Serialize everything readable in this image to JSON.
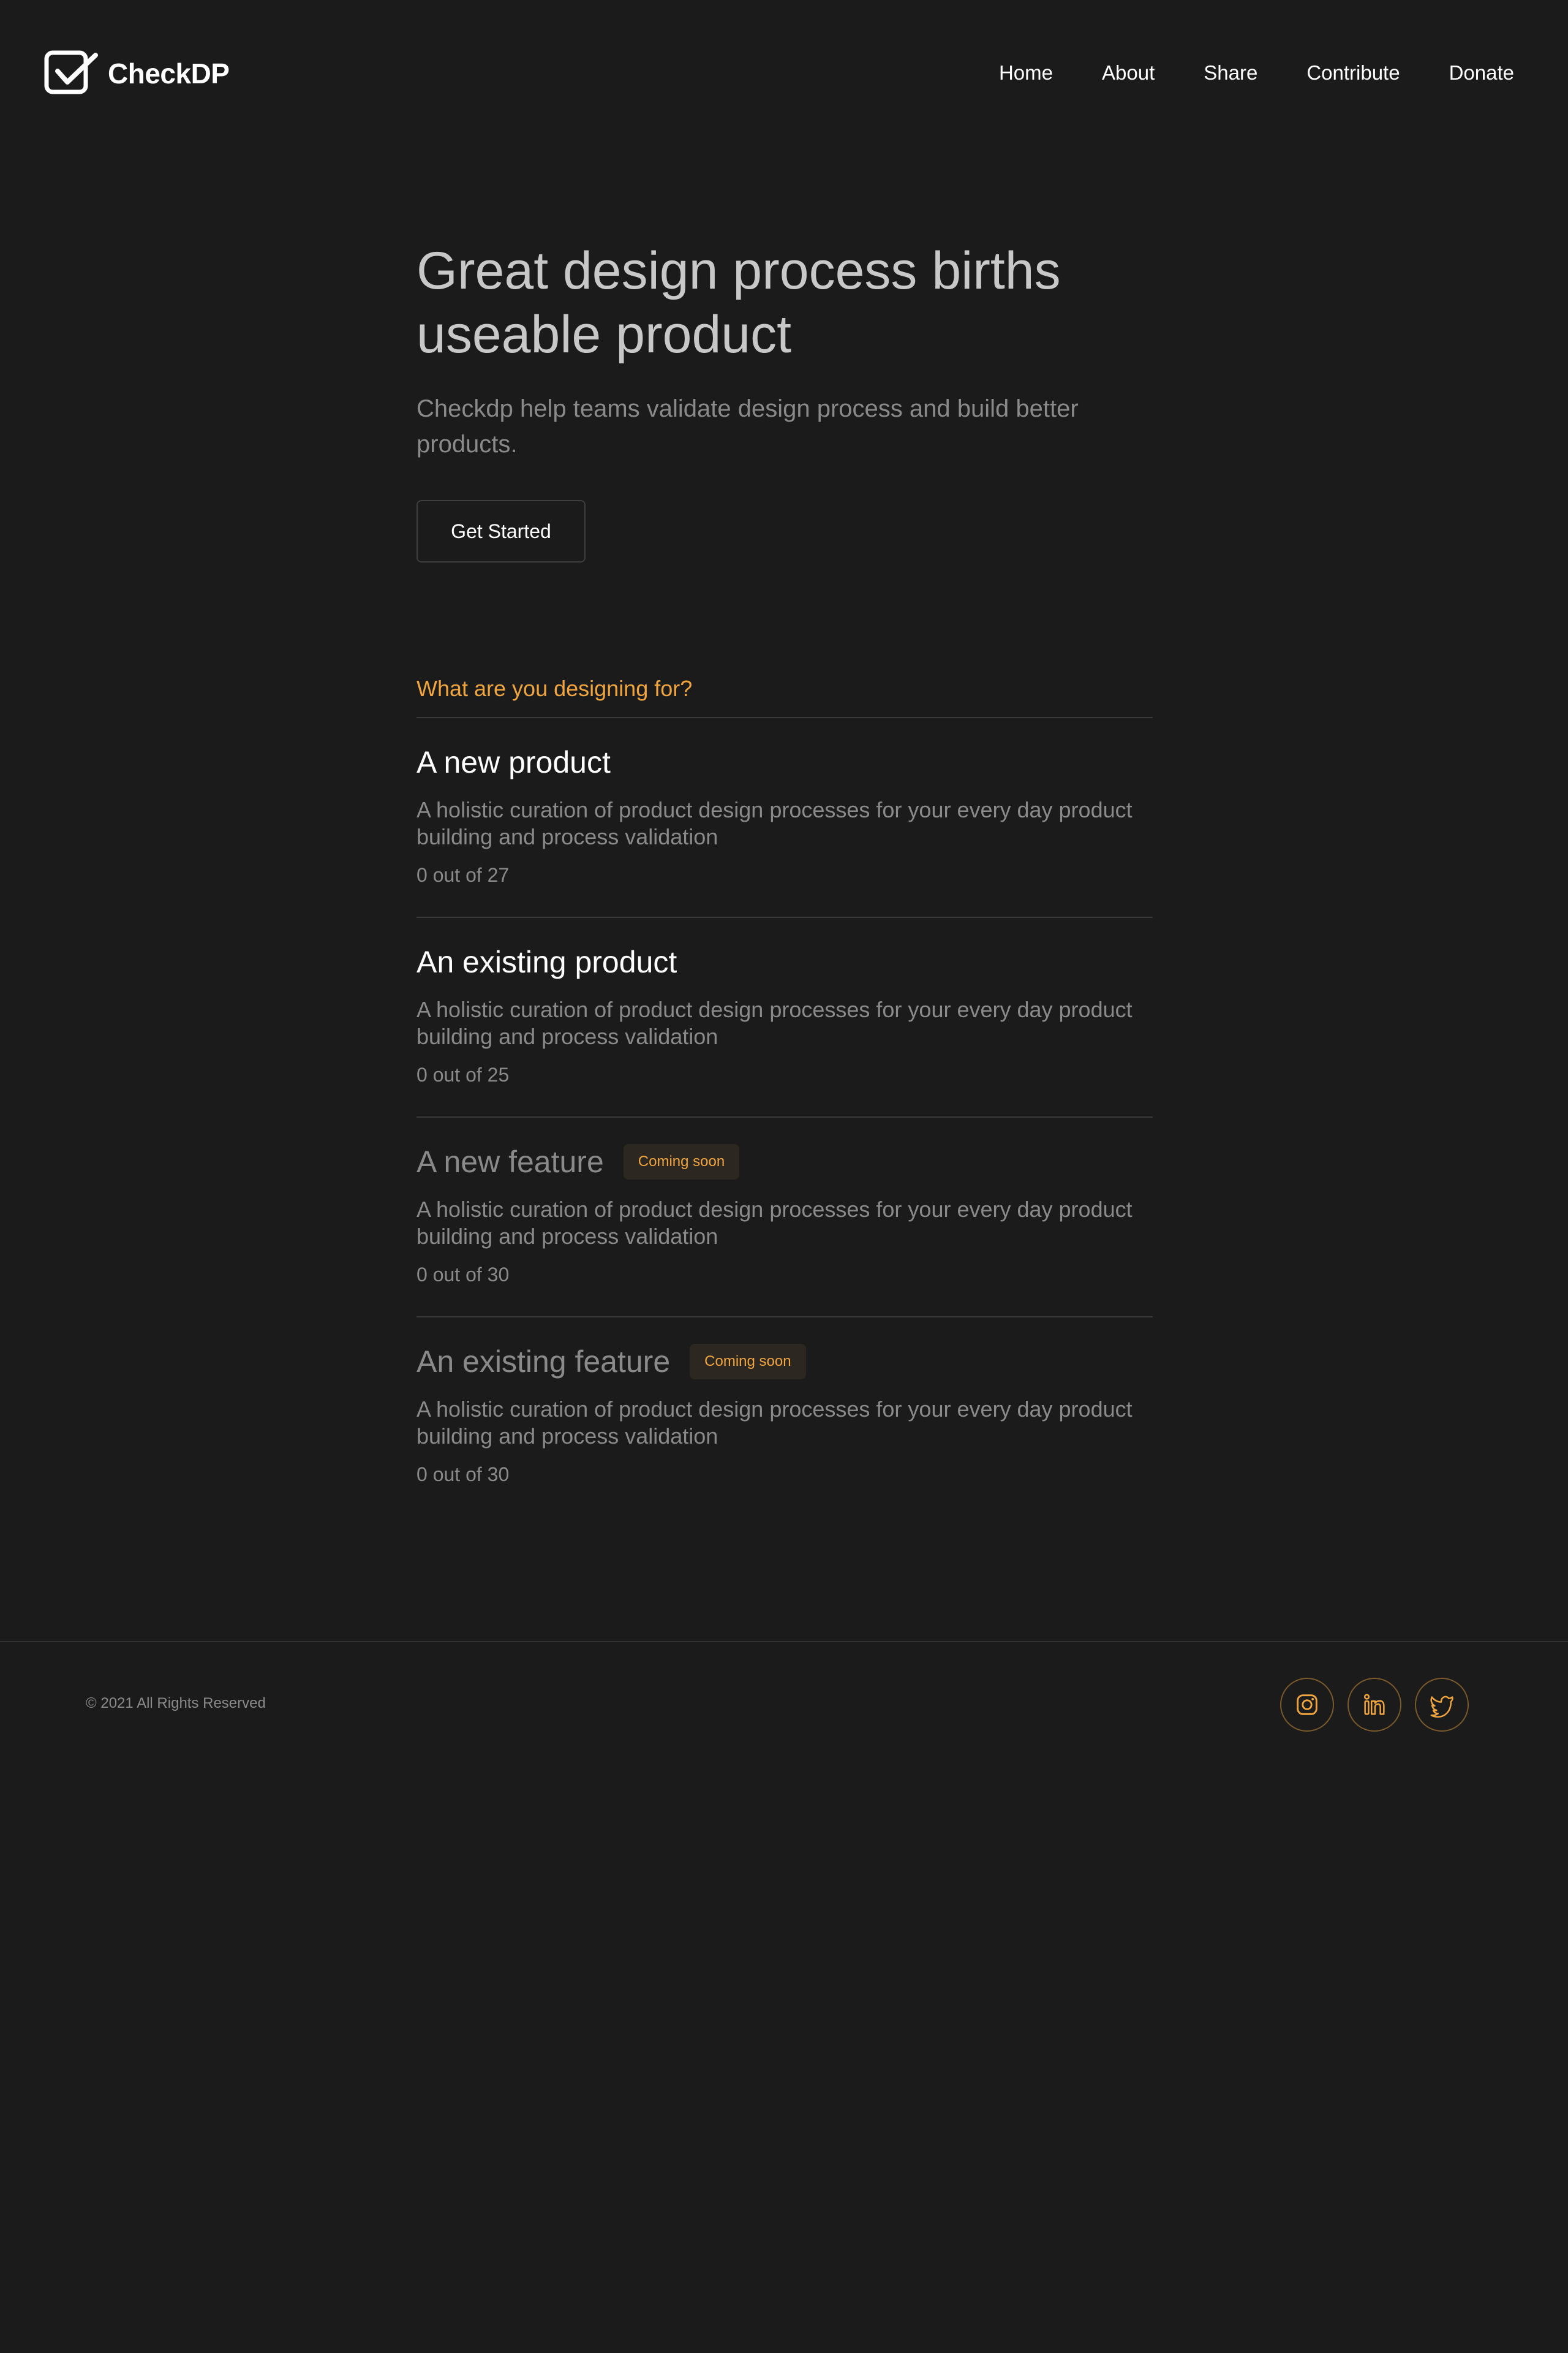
{
  "brand": {
    "name": "CheckDP",
    "logo_icon": "checkbox-check-icon"
  },
  "nav": {
    "items": [
      {
        "label": "Home"
      },
      {
        "label": "About"
      },
      {
        "label": "Share"
      },
      {
        "label": "Contribute"
      },
      {
        "label": "Donate"
      }
    ]
  },
  "hero": {
    "title": "Great design process births useable product",
    "subtitle": "Checkdp help teams validate design process and build better products.",
    "cta_label": "Get Started"
  },
  "section": {
    "heading": "What are you designing for?",
    "items": [
      {
        "title": "A new product",
        "description": "A holistic curation of product design processes for your every day product building and process validation",
        "count": "0 out of 27",
        "badge": ""
      },
      {
        "title": "An existing product",
        "description": "A holistic curation of product design processes for your every day product building and process validation",
        "count": "0 out of 25",
        "badge": ""
      },
      {
        "title": "A new feature",
        "description": "A holistic curation of product design processes for your every day product building and process validation",
        "count": "0 out of 30",
        "badge": "Coming soon"
      },
      {
        "title": "An existing feature",
        "description": "A holistic curation of product design processes for your every day product building and process validation",
        "count": "0 out of 30",
        "badge": "Coming soon"
      }
    ]
  },
  "footer": {
    "copyright": "© 2021 All Rights Reserved",
    "socials": [
      {
        "icon": "instagram-icon"
      },
      {
        "icon": "linkedin-icon"
      },
      {
        "icon": "twitter-icon"
      }
    ]
  },
  "colors": {
    "background": "#1b1b1b",
    "accent": "#f0a53f",
    "muted_text": "#8a8a8a",
    "divider": "#3a3a3a"
  }
}
